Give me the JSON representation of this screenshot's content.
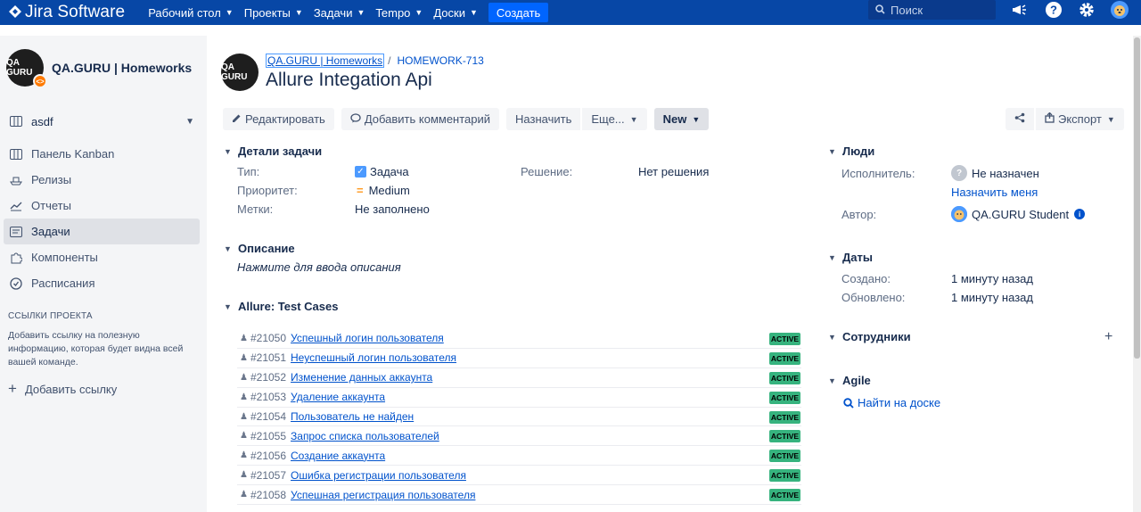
{
  "topnav": {
    "brand": "Jira Software",
    "items": [
      "Рабочий стол",
      "Проекты",
      "Задачи",
      "Tempo",
      "Доски"
    ],
    "create_label": "Создать",
    "search_placeholder": "Поиск",
    "icons": [
      "megaphone-icon",
      "help-icon",
      "gear-icon",
      "user-avatar"
    ]
  },
  "sidebar": {
    "project_avatar": "QA GURU",
    "project_name": "QA.GURU | Homeworks",
    "board": "asdf",
    "nav": [
      {
        "label": "Панель Kanban",
        "icon": "board-icon"
      },
      {
        "label": "Релизы",
        "icon": "ship-icon"
      },
      {
        "label": "Отчеты",
        "icon": "chart-icon"
      },
      {
        "label": "Задачи",
        "icon": "issues-icon",
        "active": true
      },
      {
        "label": "Компоненты",
        "icon": "puzzle-icon"
      },
      {
        "label": "Расписания",
        "icon": "clock-icon"
      }
    ],
    "links_title": "ССЫЛКИ ПРОЕКТА",
    "links_text": "Добавить ссылку на полезную информацию, которая будет видна всей вашей команде.",
    "add_link": "Добавить ссылку"
  },
  "issue": {
    "avatar": "QA GURU",
    "project": "QA.GURU | Homeworks",
    "key": "HOMEWORK-713",
    "title": "Allure Integation Api"
  },
  "toolbar": {
    "edit": "Редактировать",
    "comment": "Добавить комментарий",
    "assign": "Назначить",
    "more": "Еще...",
    "status": "New",
    "export": "Экспорт"
  },
  "details": {
    "title": "Детали задачи",
    "type_label": "Тип:",
    "type_value": "Задача",
    "priority_label": "Приоритет:",
    "priority_value": "Medium",
    "labels_label": "Метки:",
    "labels_value": "Не заполнено",
    "resolution_label": "Решение:",
    "resolution_value": "Нет решения"
  },
  "description": {
    "title": "Описание",
    "placeholder": "Нажмите для ввода описания"
  },
  "allure": {
    "title": "Allure: Test Cases",
    "cases": [
      {
        "id": "#21050",
        "name": "Успешный логин пользователя",
        "status": "ACTIVE"
      },
      {
        "id": "#21051",
        "name": "Неуспешный логин пользователя",
        "status": "ACTIVE"
      },
      {
        "id": "#21052",
        "name": "Изменение данных аккаунта",
        "status": "ACTIVE"
      },
      {
        "id": "#21053",
        "name": "Удаление аккаунта",
        "status": "ACTIVE"
      },
      {
        "id": "#21054",
        "name": "Пользователь не найден",
        "status": "ACTIVE"
      },
      {
        "id": "#21055",
        "name": "Запрос списка пользователей",
        "status": "ACTIVE"
      },
      {
        "id": "#21056",
        "name": "Создание аккаунта",
        "status": "ACTIVE"
      },
      {
        "id": "#21057",
        "name": "Ошибка регистрации пользователя",
        "status": "ACTIVE"
      },
      {
        "id": "#21058",
        "name": "Успешная регистрация пользователя",
        "status": "ACTIVE"
      }
    ]
  },
  "people": {
    "title": "Люди",
    "assignee_label": "Исполнитель:",
    "assignee_value": "Не назначен",
    "assign_me": "Назначить меня",
    "reporter_label": "Автор:",
    "reporter_value": "QA.GURU Student"
  },
  "dates": {
    "title": "Даты",
    "created_label": "Создано:",
    "created_value": "1 минуту назад",
    "updated_label": "Обновлено:",
    "updated_value": "1 минуту назад"
  },
  "collaborators": {
    "title": "Сотрудники"
  },
  "agile": {
    "title": "Agile",
    "find_on_board": "Найти на доске"
  }
}
